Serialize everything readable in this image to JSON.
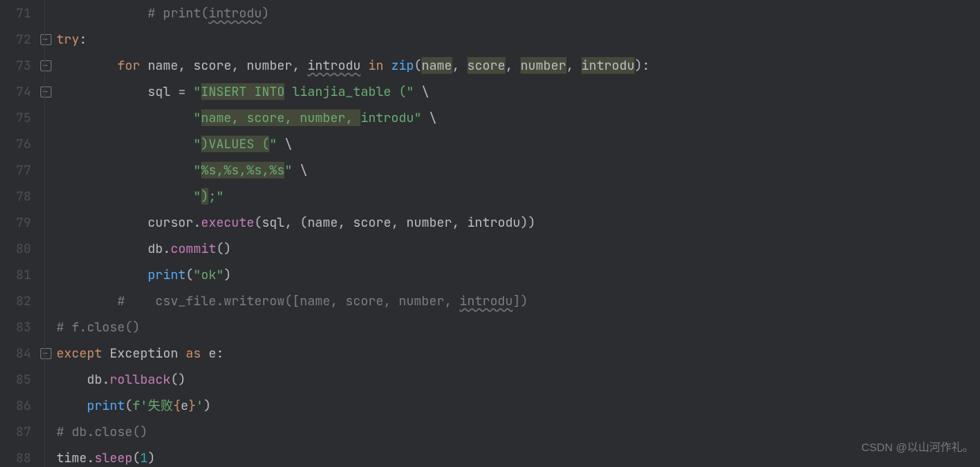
{
  "gutter": {
    "start": 71,
    "end": 88
  },
  "watermark": "CSDN @以山河作礼。",
  "code": {
    "l71": {
      "comment": "# print(introdu)",
      "var": "introdu"
    },
    "l72": {
      "try": "try",
      "colon": ":"
    },
    "l73": {
      "for": "for",
      "name": "name",
      "c1": ", ",
      "score": "score",
      "c2": ", ",
      "number": "number",
      "c3": ", ",
      "introdu": "introdu",
      "in": " in ",
      "zip": "zip",
      "p1": "(",
      "aname": "name",
      "ac1": ", ",
      "ascore": "score",
      "ac2": ", ",
      "anumber": "number",
      "ac3": ", ",
      "aintrodu": "introdu",
      "p2": "):"
    },
    "l74": {
      "var": "sql",
      "eq": " = ",
      "s1": "\"",
      "s2": "INSERT INTO",
      "s3": " lianjia_table (",
      "s4": "\"",
      " bs": " \\"
    },
    "l75": {
      "s1": "\"",
      "hl": "name, score, number, ",
      "s3": "introdu",
      "s4": "\"",
      " bs": " \\"
    },
    "l76": {
      "s1": "\"",
      "p": ")",
      "v": "VALUES (",
      "s4": "\"",
      " bs": " \\"
    },
    "l77": {
      "s1": "\"",
      "hl": "%s,%s,%s,%s",
      "s4": "\"",
      " bs": " \\"
    },
    "l78": {
      "s1": "\"",
      "p": ")",
      "semi": ";",
      "s4": "\""
    },
    "l79": {
      "cur": "cursor",
      "dot": ".",
      "exe": "execute",
      "p1": "(",
      "sql": "sql",
      "c1": ", (",
      "a": "name",
      "c2": ", ",
      "b": "score",
      "c3": ", ",
      "c": "number",
      "c4": ", ",
      "d": "introdu",
      "p2": "))"
    },
    "l80": {
      "db": "db",
      "dot": ".",
      "com": "commit",
      "p": "()"
    },
    "l81": {
      "pr": "print",
      "p1": "(",
      "s": "\"ok\"",
      "p2": ")"
    },
    "l82": {
      "hash": "#    ",
      "rest": "csv_file.writerow([name, score, number, ",
      "intr": "introdu",
      "end": "])"
    },
    "l83": {
      "c": "# f.close()"
    },
    "l84": {
      "exc": "except",
      "sp": " ",
      "excls": "Exception",
      "as": " as ",
      "e": "e",
      "colon": ":"
    },
    "l85": {
      "db": "db",
      "dot": ".",
      "rb": "rollback",
      "p": "()"
    },
    "l86": {
      "pr": "print",
      "p1": "(",
      "f": "f",
      "s1": "'",
      "txt": "失败",
      "b1": "{",
      "e": "e",
      "b2": "}",
      "s2": "'",
      "p2": ")"
    },
    "l87": {
      "c": "# db.close()"
    },
    "l88": {
      "time": "time",
      "dot": ".",
      "sleep": "sleep",
      "p1": "(",
      "n": "1",
      "p2": ")"
    }
  }
}
